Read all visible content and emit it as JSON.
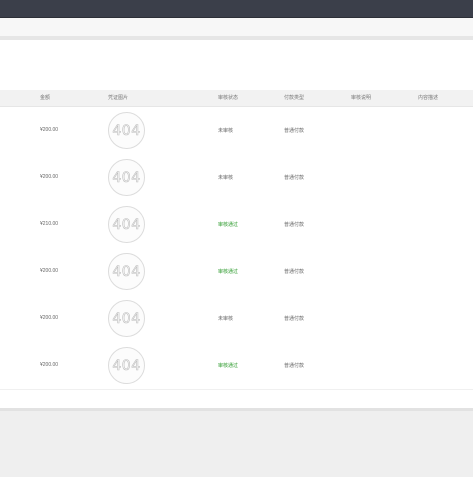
{
  "table": {
    "columns": [
      "金额",
      "凭证图片",
      "审核状态",
      "付款类型",
      "审核说明",
      "内容描述"
    ],
    "rows": [
      {
        "amount": "¥200.00",
        "image": "404",
        "status": "未审核",
        "status_ok": false,
        "pay_type": "普通付款",
        "audit_note": "",
        "desc": ""
      },
      {
        "amount": "¥200.00",
        "image": "404",
        "status": "未审核",
        "status_ok": false,
        "pay_type": "普通付款",
        "audit_note": "",
        "desc": ""
      },
      {
        "amount": "¥210.00",
        "image": "404",
        "status": "审核通过",
        "status_ok": true,
        "pay_type": "普通付款",
        "audit_note": "",
        "desc": ""
      },
      {
        "amount": "¥200.00",
        "image": "404",
        "status": "审核通过",
        "status_ok": true,
        "pay_type": "普通付款",
        "audit_note": "",
        "desc": ""
      },
      {
        "amount": "¥200.00",
        "image": "404",
        "status": "未审核",
        "status_ok": false,
        "pay_type": "普通付款",
        "audit_note": "",
        "desc": ""
      },
      {
        "amount": "¥200.00",
        "image": "404",
        "status": "审核通过",
        "status_ok": true,
        "pay_type": "普通付款",
        "audit_note": "",
        "desc": ""
      }
    ]
  },
  "colors": {
    "topbar": "#3b3f4a",
    "status_ok": "#2e9b2e",
    "text": "#666666"
  }
}
